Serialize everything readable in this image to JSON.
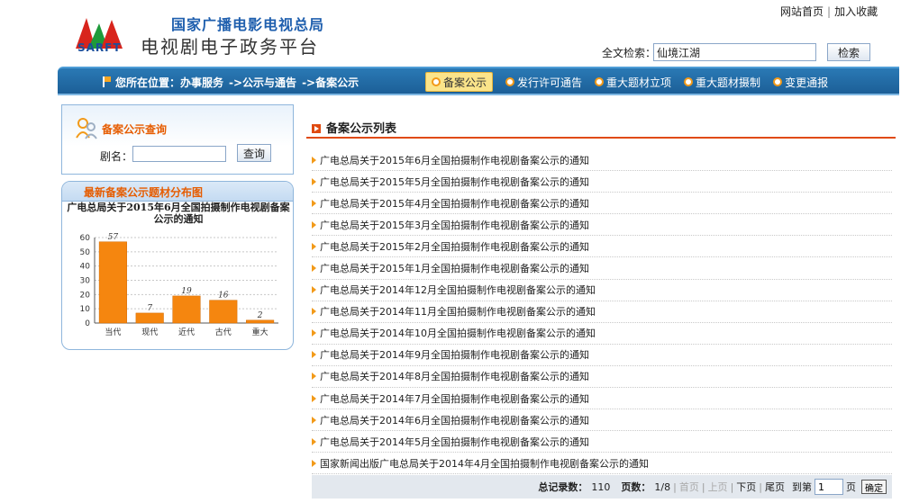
{
  "header": {
    "logo_text": "SARFT",
    "org_name": "国家广播电影电视总局",
    "site_title": "电视剧电子政务平台",
    "top_links": [
      "网站首页",
      "加入收藏"
    ],
    "search_label": "全文检索：",
    "search_value": "仙境江湖",
    "search_button": "检索"
  },
  "nav": {
    "breadcrumb": [
      "您所在位置：办事服务",
      "->公示与通告",
      "->备案公示"
    ],
    "tabs": [
      {
        "label": "备案公示",
        "active": true
      },
      {
        "label": "发行许可通告",
        "active": false
      },
      {
        "label": "重大题材立项",
        "active": false
      },
      {
        "label": "重大题材摄制",
        "active": false
      },
      {
        "label": "变更通报",
        "active": false
      }
    ]
  },
  "sidebar": {
    "query_title": "备案公示查询",
    "drama_label": "剧名：",
    "drama_value": "",
    "query_button": "查询",
    "chart_header": "最新备案公示题材分布图"
  },
  "chart_data": {
    "type": "bar",
    "title": "广电总局关于2015年6月全国拍摄制作电视剧备案公示的通知",
    "categories": [
      "当代",
      "现代",
      "近代",
      "古代",
      "重大"
    ],
    "values": [
      57,
      7,
      19,
      16,
      2
    ],
    "ylim": [
      0,
      60
    ],
    "yticks": [
      0,
      10,
      20,
      30,
      40,
      50,
      60
    ],
    "grid": true,
    "bar_color": "#f5860f",
    "xlabel": "",
    "ylabel": ""
  },
  "main": {
    "list_title": "备案公示列表",
    "items": [
      "广电总局关于2015年6月全国拍摄制作电视剧备案公示的通知",
      "广电总局关于2015年5月全国拍摄制作电视剧备案公示的通知",
      "广电总局关于2015年4月全国拍摄制作电视剧备案公示的通知",
      "广电总局关于2015年3月全国拍摄制作电视剧备案公示的通知",
      "广电总局关于2015年2月全国拍摄制作电视剧备案公示的通知",
      "广电总局关于2015年1月全国拍摄制作电视剧备案公示的通知",
      "广电总局关于2014年12月全国拍摄制作电视剧备案公示的通知",
      "广电总局关于2014年11月全国拍摄制作电视剧备案公示的通知",
      "广电总局关于2014年10月全国拍摄制作电视剧备案公示的通知",
      "广电总局关于2014年9月全国拍摄制作电视剧备案公示的通知",
      "广电总局关于2014年8月全国拍摄制作电视剧备案公示的通知",
      "广电总局关于2014年7月全国拍摄制作电视剧备案公示的通知",
      "广电总局关于2014年6月全国拍摄制作电视剧备案公示的通知",
      "广电总局关于2014年5月全国拍摄制作电视剧备案公示的通知",
      "国家新闻出版广电总局关于2014年4月全国拍摄制作电视剧备案公示的通知"
    ]
  },
  "pager": {
    "total_label": "总记录数：",
    "total_value": "110",
    "page_label": "页数：",
    "page_value": "1/8",
    "first": "首页",
    "prev": "上页",
    "next": "下页",
    "last": "尾页",
    "goto_label": "到第",
    "goto_value": "1",
    "page_unit": "页",
    "go_button": "确定"
  },
  "colors": {
    "accent": "#1c5f97",
    "orange": "#e04a10",
    "tab_active_bg": "#fbe48a"
  }
}
